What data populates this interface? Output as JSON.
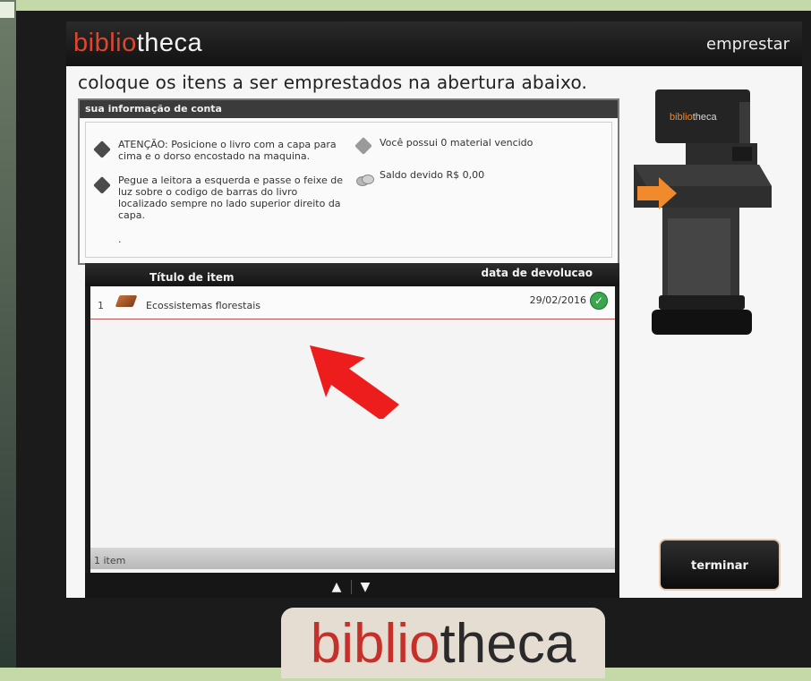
{
  "brand": {
    "name_part1": "biblio",
    "name_part2": "theca",
    "machine_label": "bibliotheca"
  },
  "mode_label": "emprestar",
  "instruction": "coloque os itens a ser emprestados na abertura abaixo.",
  "account": {
    "header": "sua informação de conta",
    "notes": [
      {
        "icon": "book-diamond-icon",
        "text": "ATENÇÃO: Posicione o livro com a capa para cima e o dorso encostado na maquina."
      },
      {
        "icon": "book-diamond-icon",
        "text": "Pegue a leitora a esquerda e passe o feixe de luz sobre o codigo de barras do livro localizado sempre no lado superior direito da capa."
      }
    ],
    "dot": ".",
    "status": [
      {
        "icon": "book-stack-icon",
        "text": "Você possui 0 material vencido"
      },
      {
        "icon": "coins-icon",
        "text": "Saldo devido R$ 0,00"
      }
    ]
  },
  "table": {
    "col_title": "Título de item",
    "col_due_date": "data de devolucao",
    "rows": [
      {
        "num": "1",
        "title": "Ecossistemas florestais",
        "due": "29/02/2016",
        "status": "ok"
      }
    ],
    "count_label": "1 item"
  },
  "scroll": {
    "up": "▲",
    "down": "▼"
  },
  "finish_label": "terminar",
  "colors": {
    "brand_red": "#e0452f",
    "accent_orange": "#f08a2c",
    "ok_green": "#3aa64d"
  }
}
